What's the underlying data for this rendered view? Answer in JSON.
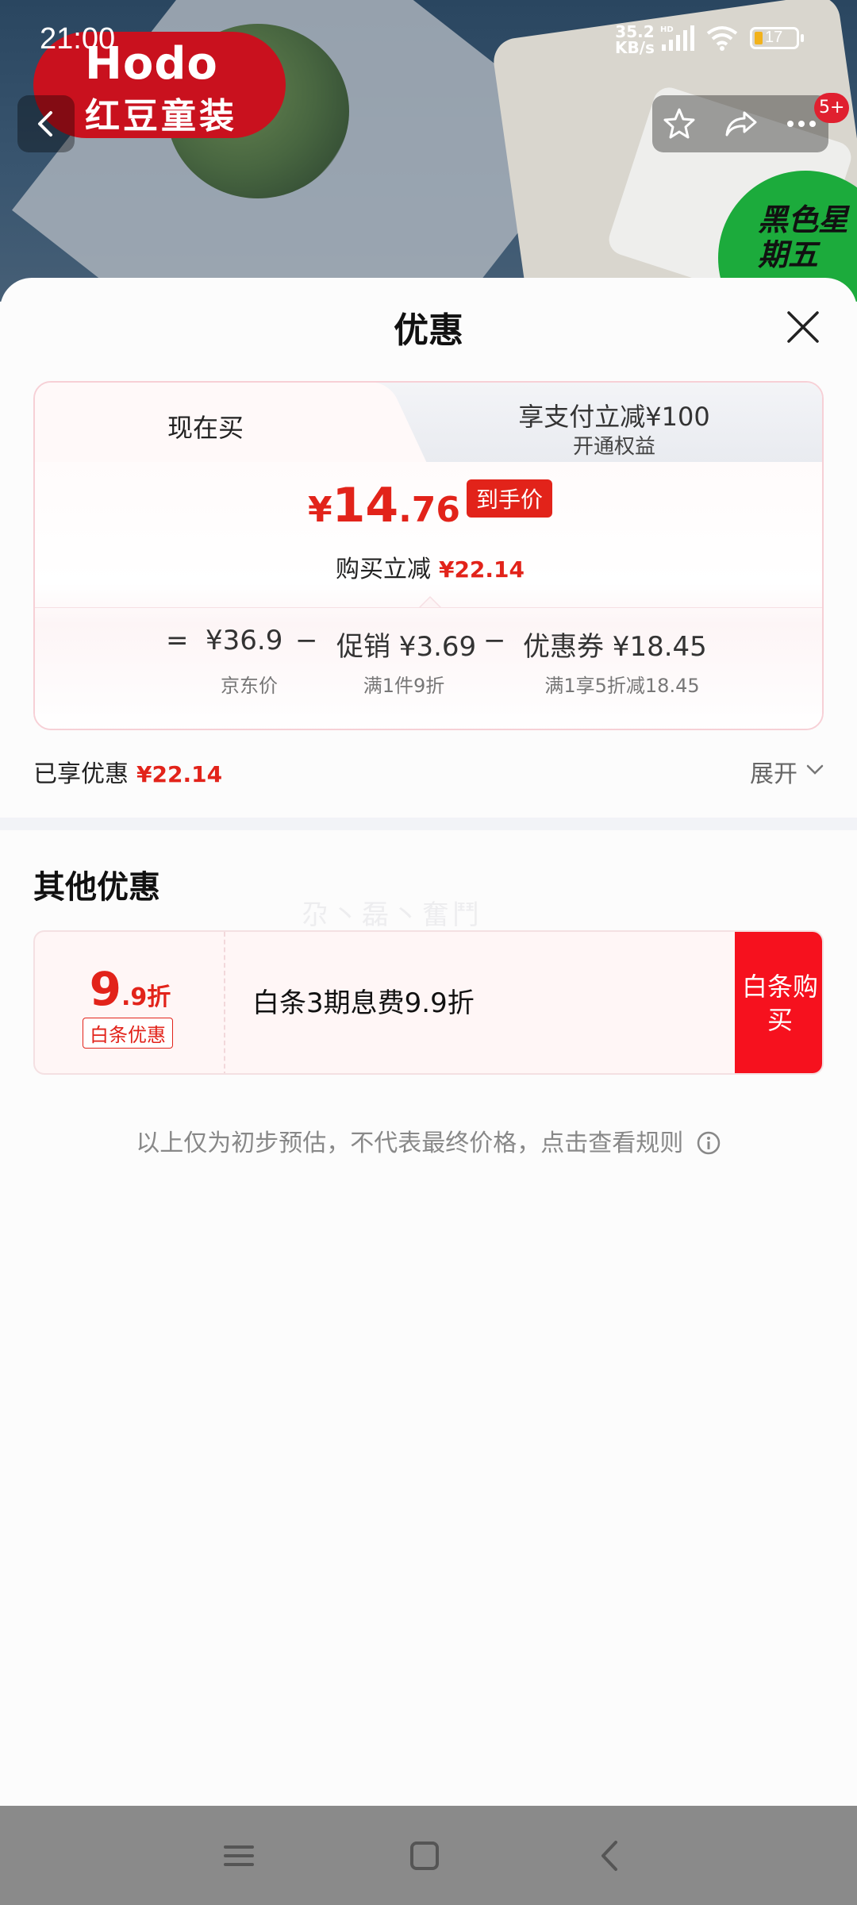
{
  "status_bar": {
    "time": "21:00",
    "net_speed_value": "35.2",
    "net_speed_unit": "KB/s",
    "hd_label": "HD",
    "battery": "17"
  },
  "background": {
    "brand_logo_text": "Hodo",
    "brand_name": "红豆童装",
    "sale_badge": "黑色星期五",
    "notification_count": "5+"
  },
  "sheet": {
    "title": "优惠",
    "tabs": [
      {
        "label": "现在买"
      },
      {
        "label": "享支付立减¥100",
        "sub": "开通权益"
      }
    ],
    "final_price": {
      "currency": "¥",
      "integer": "14",
      "decimal": ".76",
      "tag": "到手价"
    },
    "instant_reduce": {
      "label": "购买立减",
      "value": "¥22.14"
    },
    "breakdown": {
      "eq": "=",
      "jd_price": {
        "value": "¥36.9",
        "label": "京东价"
      },
      "minus1": "−",
      "promo": {
        "value": "促销 ¥3.69",
        "label": "满1件9折"
      },
      "minus2": "−",
      "coupon": {
        "value": "优惠券 ¥18.45",
        "label": "满1享5折减18.45"
      }
    },
    "enjoyed": {
      "label": "已享优惠",
      "value": "¥22.14"
    },
    "expand_label": "展开",
    "other_title": "其他优惠",
    "watermark": "尕丶磊丶奮鬥",
    "offer": {
      "discount_big": "9",
      "discount_small": ".9折",
      "tag": "白条优惠",
      "text": "白条3期息费9.9折",
      "button": "白条购买"
    },
    "disclaimer": "以上仅为初步预估，不代表最终价格，点击查看规则"
  },
  "colors": {
    "accent": "#e2231a",
    "button": "#f6111e"
  },
  "icons": [
    "back-icon",
    "star-icon",
    "share-icon",
    "more-icon",
    "close-icon",
    "chevron-down-icon",
    "info-icon",
    "menu-icon",
    "home-icon",
    "nav-back-icon"
  ]
}
